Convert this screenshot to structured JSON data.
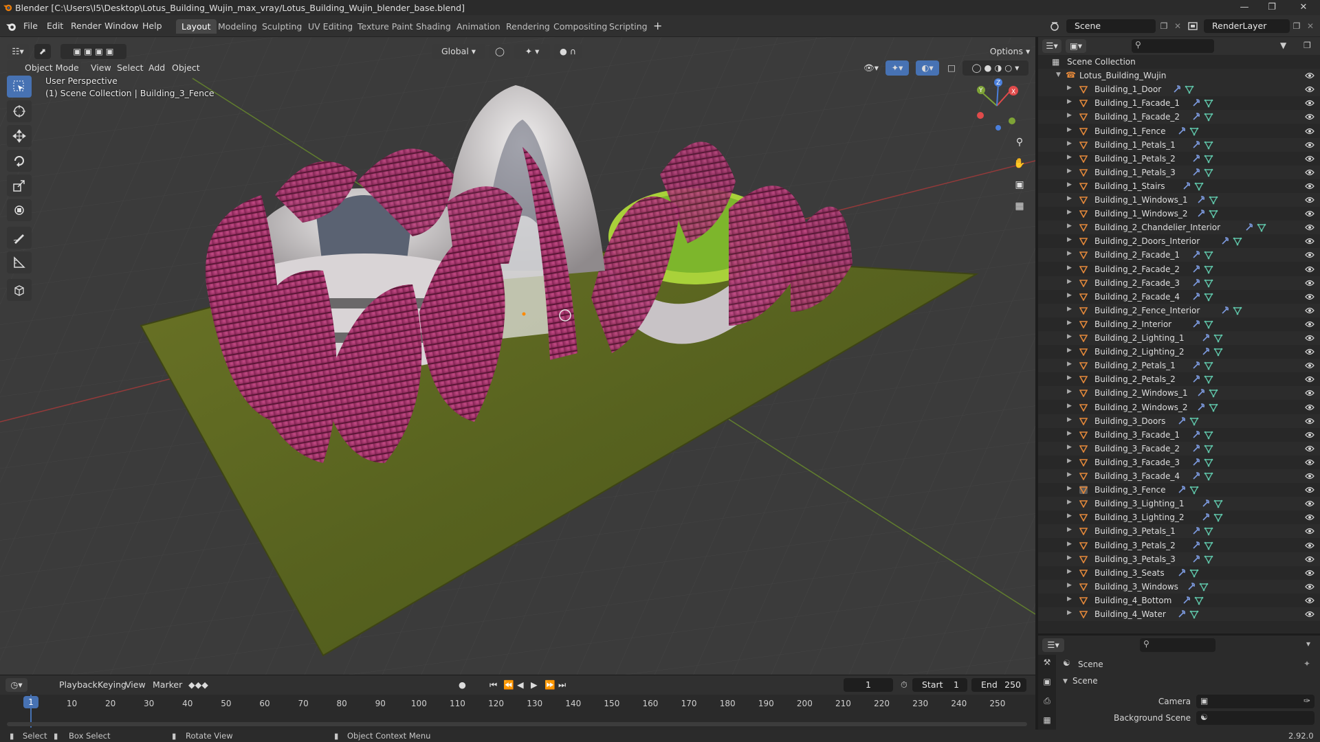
{
  "window": {
    "title": "Blender [C:\\Users\\I5\\Desktop\\Lotus_Building_Wujin_max_vray/Lotus_Building_Wujin_blender_base.blend]"
  },
  "menu": [
    "File",
    "Edit",
    "Render",
    "Window",
    "Help"
  ],
  "workspaces": [
    "Layout",
    "Modeling",
    "Sculpting",
    "UV Editing",
    "Texture Paint",
    "Shading",
    "Animation",
    "Rendering",
    "Compositing",
    "Scripting"
  ],
  "active_workspace": "Layout",
  "scene_field": "Scene",
  "renderlayer_field": "RenderLayer",
  "viewport": {
    "mode": "Object Mode",
    "menus": [
      "View",
      "Select",
      "Add",
      "Object"
    ],
    "orientation": "Global",
    "options_label": "Options",
    "perspective_label": "User Perspective",
    "context_label": "(1) Scene Collection | Building_3_Fence",
    "gizmo": {
      "x": "X",
      "y": "Y",
      "z": "Z"
    }
  },
  "outliner": {
    "root": "Scene Collection",
    "collection": "Lotus_Building_Wujin",
    "items": [
      "Building_1_Door",
      "Building_1_Facade_1",
      "Building_1_Facade_2",
      "Building_1_Fence",
      "Building_1_Petals_1",
      "Building_1_Petals_2",
      "Building_1_Petals_3",
      "Building_1_Stairs",
      "Building_1_Windows_1",
      "Building_1_Windows_2",
      "Building_2_Chandelier_Interior",
      "Building_2_Doors_Interior",
      "Building_2_Facade_1",
      "Building_2_Facade_2",
      "Building_2_Facade_3",
      "Building_2_Facade_4",
      "Building_2_Fence_Interior",
      "Building_2_Interior",
      "Building_2_Lighting_1",
      "Building_2_Lighting_2",
      "Building_2_Petals_1",
      "Building_2_Petals_2",
      "Building_2_Windows_1",
      "Building_2_Windows_2",
      "Building_3_Doors",
      "Building_3_Facade_1",
      "Building_3_Facade_2",
      "Building_3_Facade_3",
      "Building_3_Facade_4",
      "Building_3_Fence",
      "Building_3_Lighting_1",
      "Building_3_Lighting_2",
      "Building_3_Petals_1",
      "Building_3_Petals_2",
      "Building_3_Petals_3",
      "Building_3_Seats",
      "Building_3_Windows",
      "Building_4_Bottom",
      "Building_4_Water"
    ],
    "selected_item": "Building_3_Fence"
  },
  "properties": {
    "header": "Scene",
    "panel": "Scene",
    "camera_label": "Camera",
    "background_label": "Background Scene"
  },
  "timeline": {
    "menus": [
      "Playback",
      "Keying",
      "View",
      "Marker"
    ],
    "current_frame": "1",
    "start_label": "Start",
    "start_value": "1",
    "end_label": "End",
    "end_value": "250",
    "ticks": [
      "1",
      "10",
      "20",
      "30",
      "40",
      "50",
      "60",
      "70",
      "80",
      "90",
      "100",
      "110",
      "120",
      "130",
      "140",
      "150",
      "160",
      "170",
      "180",
      "190",
      "200",
      "210",
      "220",
      "230",
      "240",
      "250"
    ]
  },
  "statusbar": {
    "select": "Select",
    "box_select": "Box Select",
    "rotate": "Rotate View",
    "context_menu": "Object Context Menu",
    "version": "2.92.0"
  },
  "colors": {
    "accent": "#4772b3",
    "petal": "#b0346e",
    "grass": "#5f6b22",
    "object_icon": "#e3883a",
    "mesh_icon": "#5fc4a8"
  }
}
